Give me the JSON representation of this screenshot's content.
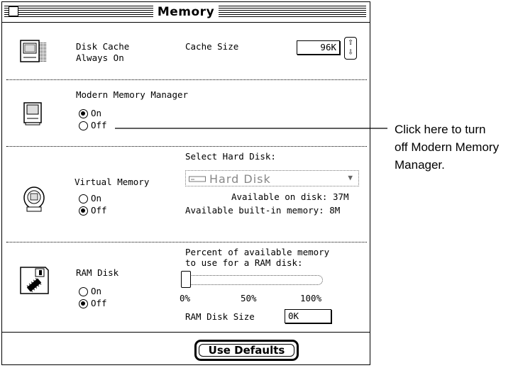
{
  "window": {
    "title": "Memory"
  },
  "disk_cache": {
    "label_line1": "Disk Cache",
    "label_line2": "Always On",
    "cache_size_label": "Cache Size",
    "cache_size_value": "96K"
  },
  "modern_memory": {
    "title": "Modern Memory Manager",
    "on_label": "On",
    "off_label": "Off",
    "selected": "On"
  },
  "virtual_memory": {
    "title": "Virtual Memory",
    "on_label": "On",
    "off_label": "Off",
    "selected": "Off",
    "select_disk_label": "Select Hard Disk:",
    "disk_name": "Hard Disk",
    "available_on_disk": "Available on disk: 37M",
    "available_builtin": "Available built-in memory: 8M"
  },
  "ram_disk": {
    "title": "RAM Disk",
    "on_label": "On",
    "off_label": "Off",
    "selected": "Off",
    "percent_label_line1": "Percent of available memory",
    "percent_label_line2": "to use for a RAM disk:",
    "ticks": [
      "0%",
      "50%",
      "100%"
    ],
    "slider_value_percent": 0,
    "size_label": "RAM Disk Size",
    "size_value": "0K"
  },
  "footer": {
    "use_defaults_label": "Use Defaults"
  },
  "callout": {
    "line1": "Click here to turn",
    "line2": "off Modern Memory",
    "line3": "Manager."
  }
}
